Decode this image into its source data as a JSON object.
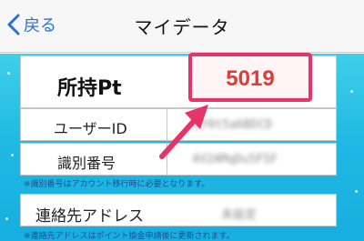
{
  "header": {
    "back_label": "戻る",
    "title": "マイデータ"
  },
  "mydata": {
    "points_label": "所持Pt",
    "points_value": "5019",
    "user_id_label": "ユーザーID",
    "user_id_value": "aY0t5a6BDCD",
    "id_number_label": "識別番号",
    "id_number_value": "4V2AMqDu5F5F",
    "id_number_note": "※識別番号はアカウント移行時に必要となります。",
    "contact_label": "連絡先アドレス",
    "contact_value": "未設定",
    "contact_note": "※連絡先アドレスはポイント換金申請後に更新されます。"
  },
  "colors": {
    "accent": "#2a6fd6",
    "highlight": "#e8336a",
    "points": "#e23b36",
    "background": "#1fb8e3"
  }
}
